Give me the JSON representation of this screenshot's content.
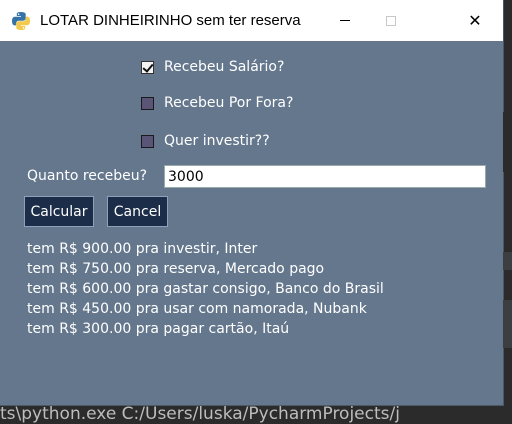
{
  "window": {
    "title": "LOTAR DINHEIRINHO sem ter reserva",
    "controls": {
      "minimize": "minimize",
      "maximize": "maximize",
      "close": "✕"
    }
  },
  "options": [
    {
      "label": "Recebeu Salário?",
      "checked": true
    },
    {
      "label": "Recebeu Por Fora?",
      "checked": false
    },
    {
      "label": "Quer investir??",
      "checked": false
    }
  ],
  "amount": {
    "label": "Quanto recebeu?",
    "value": "3000"
  },
  "buttons": {
    "calculate": "Calcular",
    "cancel": "Cancel"
  },
  "results": [
    "tem R$ 900.00 pra investir, Inter",
    "tem R$ 750.00 pra reserva, Mercado pago",
    "tem R$ 600.00 pra gastar consigo, Banco do Brasil",
    "tem R$ 450.00 pra usar com namorada, Nubank",
    "tem R$ 300.00 pra pagar cartão, Itaú"
  ],
  "background": {
    "terminal_line": "ts\\python.exe C:/Users/luska/PycharmProjects/j"
  },
  "colors": {
    "window_bg": "#64778d",
    "button_bg": "#1c2d49",
    "titlebar_bg": "#ffffff"
  }
}
